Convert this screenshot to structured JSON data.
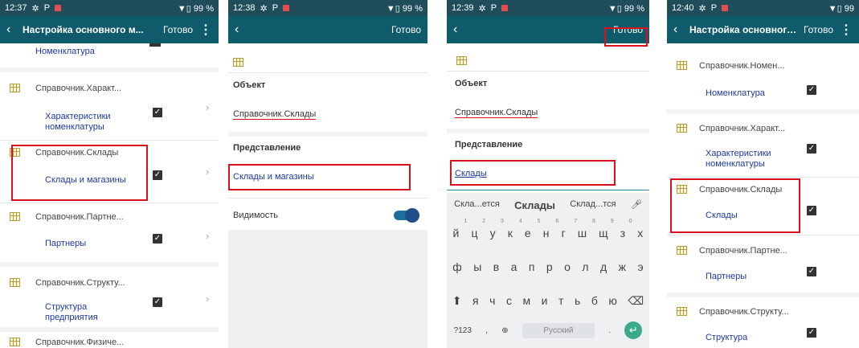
{
  "screens": [
    {
      "status": {
        "time": "12:37",
        "right": "▼▯ 99 %"
      },
      "appbar": {
        "title": "Настройка основного м...",
        "done": "Готово"
      },
      "items": [
        {
          "title": "Номенклатура"
        },
        {
          "title": "Справочник.Характ...",
          "value": "Характеристики номенклатуры"
        },
        {
          "title": "Справочник.Склады",
          "value": "Склады и магазины"
        },
        {
          "title": "Справочник.Партне...",
          "value": "Партнеры"
        },
        {
          "title": "Справочник.Структу...",
          "value": "Структура предприятия"
        },
        {
          "title": "Справочник.Физиче..."
        }
      ]
    },
    {
      "status": {
        "time": "12:38",
        "right": "▼▯ 99 %"
      },
      "appbar": {
        "done": "Готово"
      },
      "object_label": "Объект",
      "object_value": "Справочник.Склады",
      "repr_label": "Представление",
      "repr_value": "Склады и магазины",
      "visibility_label": "Видимость"
    },
    {
      "status": {
        "time": "12:39",
        "right": "▼▯ 99 %"
      },
      "appbar": {
        "done": "Готово"
      },
      "object_label": "Объект",
      "object_value": "Справочник.Склады",
      "repr_label": "Представление",
      "repr_value": "Склады",
      "keyboard": {
        "suggestions": [
          "Скла...ется",
          "Склады",
          "Склад...тся"
        ],
        "row1": [
          "й",
          "ц",
          "у",
          "к",
          "е",
          "н",
          "г",
          "ш",
          "щ",
          "з",
          "х"
        ],
        "row1_nums": [
          "1",
          "2",
          "3",
          "4",
          "5",
          "6",
          "7",
          "8",
          "9",
          "0"
        ],
        "row2": [
          "ф",
          "ы",
          "в",
          "а",
          "п",
          "р",
          "о",
          "л",
          "д",
          "ж",
          "э"
        ],
        "row3": [
          "я",
          "ч",
          "с",
          "м",
          "и",
          "т",
          "ь",
          "б",
          "ю"
        ],
        "bottom_left": "?123",
        "space": "Русский"
      }
    },
    {
      "status": {
        "time": "12:40",
        "right": "▼▯ 99"
      },
      "appbar": {
        "title": "Настройка основного м...",
        "done": "Готово"
      },
      "items": [
        {
          "title": "Справочник.Номен...",
          "value": "Номенклатура"
        },
        {
          "title": "Справочник.Характ...",
          "value": "Характеристики номенклатуры"
        },
        {
          "title": "Справочник.Склады",
          "value": "Склады"
        },
        {
          "title": "Справочник.Партне...",
          "value": "Партнеры"
        },
        {
          "title": "Справочник.Структу...",
          "value": "Структура"
        }
      ]
    }
  ]
}
